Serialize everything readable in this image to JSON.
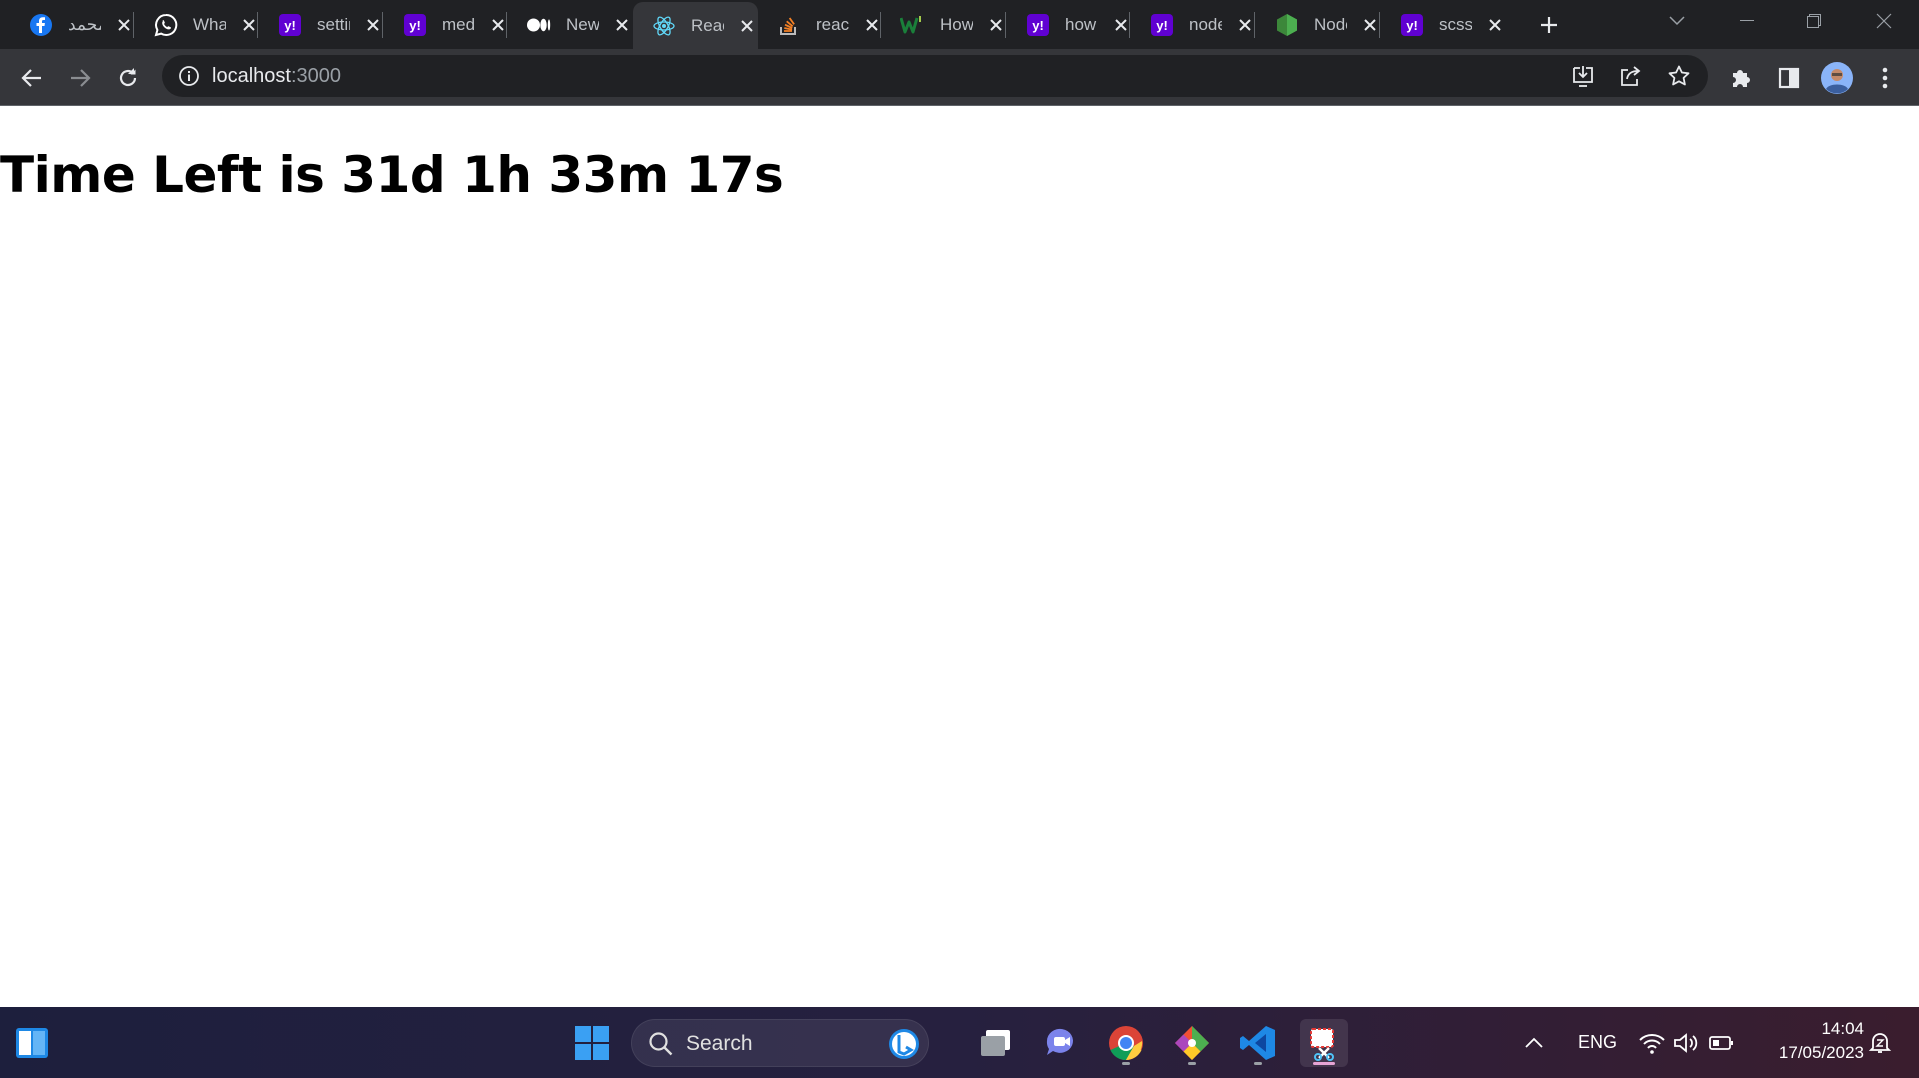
{
  "browser": {
    "tabs": [
      {
        "title": "محمد",
        "favicon": "facebook-icon",
        "color": "#1877f2"
      },
      {
        "title": "WhatsApp",
        "favicon": "whatsapp-icon",
        "color": "#ffffff"
      },
      {
        "title": "setting",
        "favicon": "yahoo-icon",
        "color": "#6001d2"
      },
      {
        "title": "media",
        "favicon": "yahoo-icon",
        "color": "#6001d2"
      },
      {
        "title": "New",
        "favicon": "medium-icon",
        "color": "#ffffff"
      },
      {
        "title": "React",
        "favicon": "react-icon",
        "color": "#61dafb",
        "active": true
      },
      {
        "title": "react",
        "favicon": "stackoverflow-icon",
        "color": "#f48024"
      },
      {
        "title": "How",
        "favicon": "wikihow-icon",
        "color": "#1a7f3a"
      },
      {
        "title": "how",
        "favicon": "yahoo-icon",
        "color": "#6001d2"
      },
      {
        "title": "node",
        "favicon": "yahoo-icon",
        "color": "#6001d2"
      },
      {
        "title": "Node",
        "favicon": "nodejs-icon",
        "color": "#3c873a"
      },
      {
        "title": "scss",
        "favicon": "yahoo-icon",
        "color": "#6001d2"
      }
    ],
    "url_host": "localhost",
    "url_port": ":3000"
  },
  "page": {
    "heading": "Time Left is 31d 1h 33m 17s"
  },
  "taskbar": {
    "search_placeholder": "Search",
    "language": "ENG",
    "time": "14:04",
    "date": "17/05/2023"
  }
}
